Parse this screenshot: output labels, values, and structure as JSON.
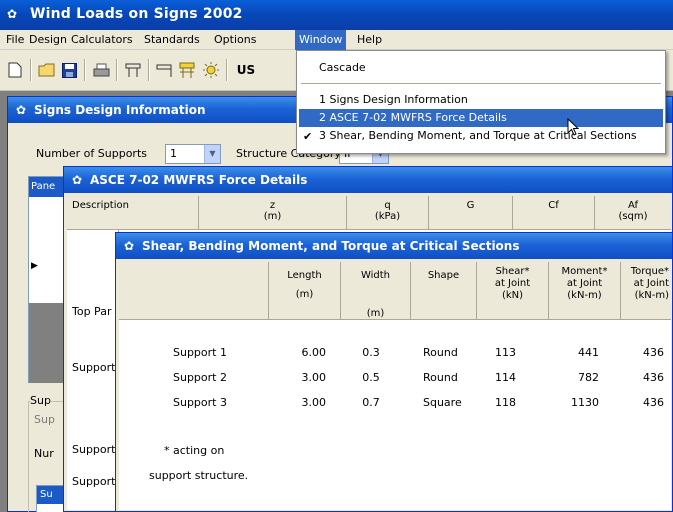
{
  "app": {
    "title": "Wind Loads on Signs 2002"
  },
  "menubar": {
    "items": [
      "File",
      "Design",
      "Calculators",
      "Standards",
      "Options",
      "Window",
      "Help"
    ],
    "active": "Window"
  },
  "toolbar": {
    "us_label": "US"
  },
  "window_menu": {
    "items": [
      {
        "label": "Cascade"
      },
      {
        "label": "1 Signs Design Information"
      },
      {
        "label": "2 ASCE 7-02 MWFRS Force Details"
      },
      {
        "label": "3 Shear, Bending Moment, and Torque at Critical Sections",
        "checked": true
      }
    ],
    "check_glyph": "✔"
  },
  "signs_window": {
    "title": "Signs Design Information",
    "num_supports_label": "Number of Supports",
    "num_supports_value": "1",
    "structure_category_label": "Structure Category",
    "structure_category_value": "II",
    "pane_label": "Pane",
    "sup_group": "Sup",
    "sup_label": "Sup",
    "num_label": "Nur",
    "s_label": "Su"
  },
  "asce_window": {
    "title": "ASCE 7-02 MWFRS Force Details",
    "headers": [
      {
        "top": "Description",
        "unit": ""
      },
      {
        "top": "z",
        "unit": "(m)"
      },
      {
        "top": "q",
        "unit": "(kPa)"
      },
      {
        "top": "G",
        "unit": ""
      },
      {
        "top": "Cf",
        "unit": ""
      },
      {
        "top": "Af",
        "unit": "(sqm)"
      }
    ],
    "row_labels": [
      "Top Par",
      "Support",
      "Support",
      "Support"
    ]
  },
  "shear_window": {
    "title": "Shear, Bending Moment, and Torque at Critical Sections",
    "headers": [
      {
        "lines": [
          "Length",
          "",
          "(m)"
        ]
      },
      {
        "lines": [
          "Width",
          "",
          "(m)"
        ]
      },
      {
        "lines": [
          "Shape",
          "",
          ""
        ]
      },
      {
        "lines": [
          "Shear*",
          "at Joint",
          "(kN)"
        ]
      },
      {
        "lines": [
          "Moment*",
          "at Joint",
          "(kN-m)"
        ]
      },
      {
        "lines": [
          "Torque*",
          "at Joint",
          "(kN-m)"
        ]
      }
    ],
    "rows": [
      {
        "name": "Support 1",
        "length": "6.00",
        "width": "0.3",
        "shape": "Round",
        "shear": "113",
        "moment": "441",
        "torque": "436"
      },
      {
        "name": "Support 2",
        "length": "3.00",
        "width": "0.5",
        "shape": "Round",
        "shear": "114",
        "moment": "782",
        "torque": "436"
      },
      {
        "name": "Support 3",
        "length": "3.00",
        "width": "0.7",
        "shape": "Square",
        "shear": "118",
        "moment": "1130",
        "torque": "436"
      }
    ],
    "footnote_line1": "* acting on",
    "footnote_line2": "support structure."
  }
}
